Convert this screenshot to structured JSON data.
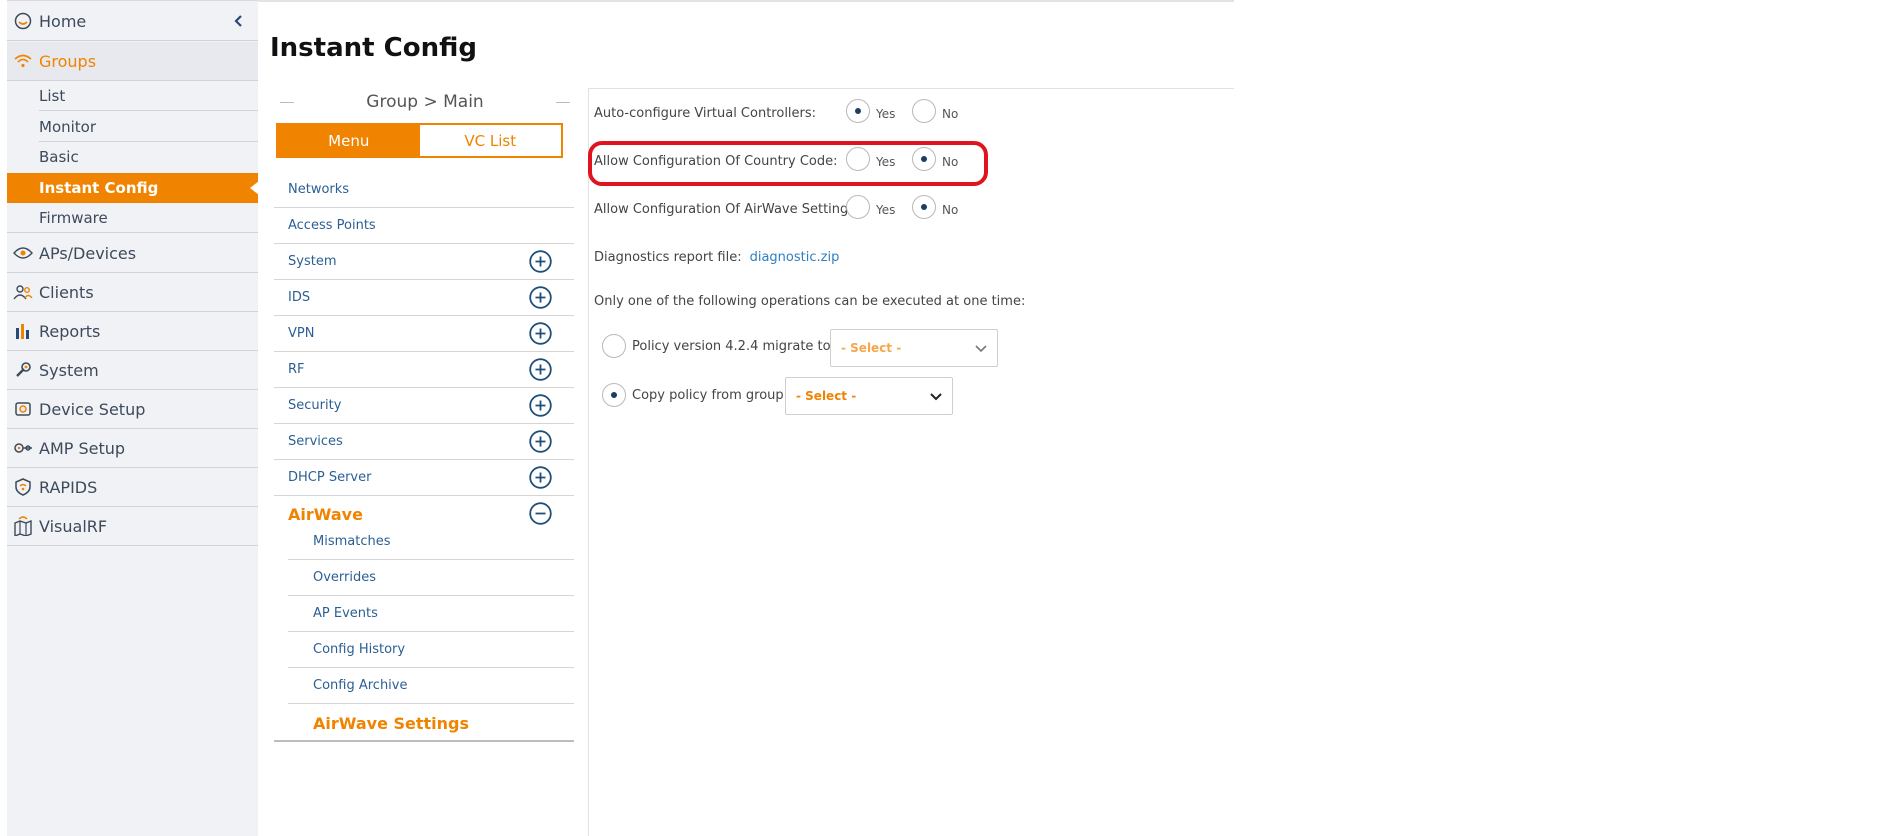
{
  "page": {
    "title": "Instant Config"
  },
  "leftnav": {
    "home": "Home",
    "groups": "Groups",
    "groups_sub": [
      "List",
      "Monitor",
      "Basic",
      "Instant Config",
      "Firmware"
    ],
    "items": [
      "APs/Devices",
      "Clients",
      "Reports",
      "System",
      "Device Setup",
      "AMP Setup",
      "RAPIDS",
      "VisualRF"
    ],
    "accent": "#f08300"
  },
  "middle": {
    "breadcrumb": "Group > Main",
    "toggle": {
      "menu": "Menu",
      "vc_list": "VC List"
    },
    "menu_items": [
      "Networks",
      "Access Points",
      "System",
      "IDS",
      "VPN",
      "RF",
      "Security",
      "Services",
      "DHCP Server"
    ],
    "airwave": "AirWave",
    "airwave_items": [
      "Mismatches",
      "Overrides",
      "AP Events",
      "Config History",
      "Config Archive"
    ],
    "airwave_settings": "AirWave Settings"
  },
  "form": {
    "auto_configure": {
      "label": "Auto-configure Virtual Controllers:",
      "yes": "Yes",
      "no": "No",
      "selected": "Yes"
    },
    "country_code": {
      "label": "Allow Configuration Of Country Code:",
      "yes": "Yes",
      "no": "No",
      "selected": "No"
    },
    "airwave_settings": {
      "label": "Allow Configuration Of AirWave Settings:",
      "yes": "Yes",
      "no": "No",
      "selected": "No"
    },
    "diagnostics": {
      "label": "Diagnostics report file:",
      "link": "diagnostic.zip"
    },
    "operations_note": "Only one of the following operations can be executed at one time:",
    "policy_migrate": {
      "label": "Policy version 4.2.4 migrate to:",
      "value": "- Select -"
    },
    "copy_policy": {
      "label": "Copy policy from group:",
      "value": "- Select -"
    }
  }
}
